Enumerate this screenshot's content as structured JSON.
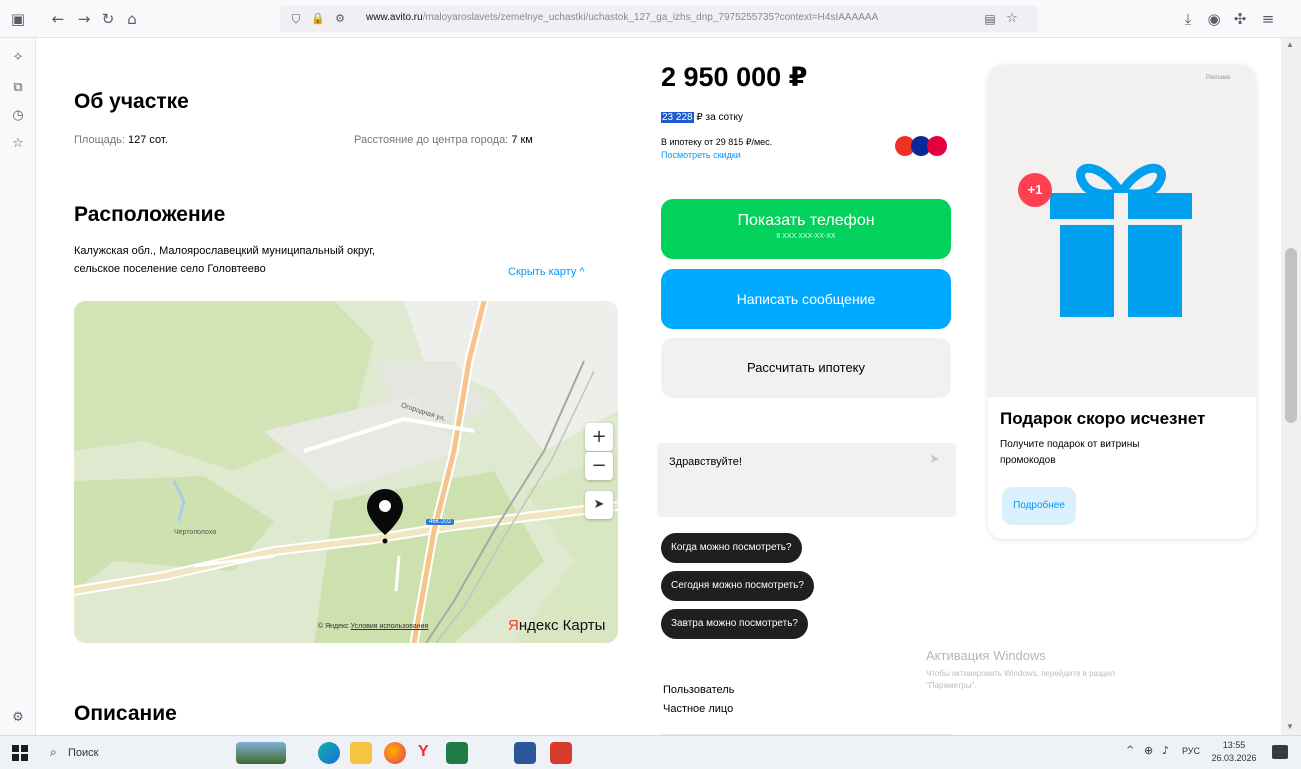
{
  "browser": {
    "url_domain": "www.avito.ru",
    "url_path": "/maloyaroslavets/zemelnye_uchastki/uchastok_127_ga_izhs_dnp_7975255735?context=H4sIAAAAAA",
    "icons": [
      "sidebar-toggle-icon",
      "back-arrow-icon",
      "forward-arrow-icon",
      "reload-icon",
      "home-icon",
      "shield-icon",
      "lock-icon",
      "permissions-icon",
      "reader-view-icon",
      "bookmark-star-icon",
      "download-icon",
      "account-icon",
      "extensions-icon",
      "overflow-icon"
    ]
  },
  "sidebar": {
    "icons": [
      "ai-chatbot-icon",
      "synced-tabs-icon",
      "history-icon",
      "bookmarks-icon",
      "settings-gear-icon"
    ]
  },
  "about": {
    "heading": "Об участке",
    "area_label": "Площадь:",
    "area_value": "127 сот.",
    "distance_label": "Расстояние до центра города:",
    "distance_value": "7 км"
  },
  "location": {
    "heading": "Расположение",
    "address_line1": "Калужская обл., Малоярославецкий муниципальный округ,",
    "address_line2": "сельское поселение село Головтеево",
    "hide_map": "Скрыть карту ^"
  },
  "map": {
    "road_label": "Огородная ул.",
    "village_label": "Чертополоха",
    "road_badge": "46К-202",
    "zoom_in": "+",
    "zoom_out": "−",
    "copyright": "© Яндекс",
    "terms": "Условия использования",
    "brand_red": "Я",
    "brand_rest": "ндекс Карты"
  },
  "price": {
    "value": "2 950 000 ₽",
    "per_unit_highlight": "23 228",
    "per_unit_rest": "₽ за сотку",
    "mortgage": "В ипотеку от 29 815 ₽/мес.",
    "discounts_link": "Посмотреть скидки"
  },
  "actions": {
    "show_phone": "Показать телефон",
    "phone_mask": "8 XXX XXX-XX-XX",
    "write_message": "Написать сообщение",
    "calc_mortgage": "Рассчитать ипотеку"
  },
  "chat": {
    "message_value": "Здравствуйте!",
    "quick_replies": [
      "Когда можно посмотреть?",
      "Сегодня можно посмотреть?",
      "Завтра можно посмотреть?"
    ]
  },
  "seller": {
    "name": "Пользователь",
    "type": "Частное лицо"
  },
  "ad": {
    "tag": "Реклама",
    "badge": "+1",
    "title": "Подарок скоро исчезнет",
    "text_line1": "Получите подарок от витрины",
    "text_line2": "промокодов",
    "button": "Подробнее"
  },
  "description": {
    "heading": "Описание"
  },
  "watermark": {
    "title": "Активация Windows",
    "text_line1": "Чтобы активировать Windows, перейдите в раздел",
    "text_line2": "\"Параметры\"."
  },
  "taskbar": {
    "search_placeholder": "Поиск",
    "language": "РУС",
    "time": "13:55",
    "date": "26.03.2026",
    "apps": [
      "landscape-widget-icon",
      "edge-icon",
      "file-explorer-icon",
      "firefox-icon",
      "yandex-browser-icon",
      "excel-icon",
      "word-icon",
      "pdf-reader-icon"
    ]
  },
  "colors": {
    "accent_green": "#02d15c",
    "accent_blue": "#00aaff",
    "link_blue": "#0099f7",
    "chip_dark": "#1f1f1f",
    "gift_blue": "#00a0ef",
    "badge_red": "#ff4053"
  }
}
